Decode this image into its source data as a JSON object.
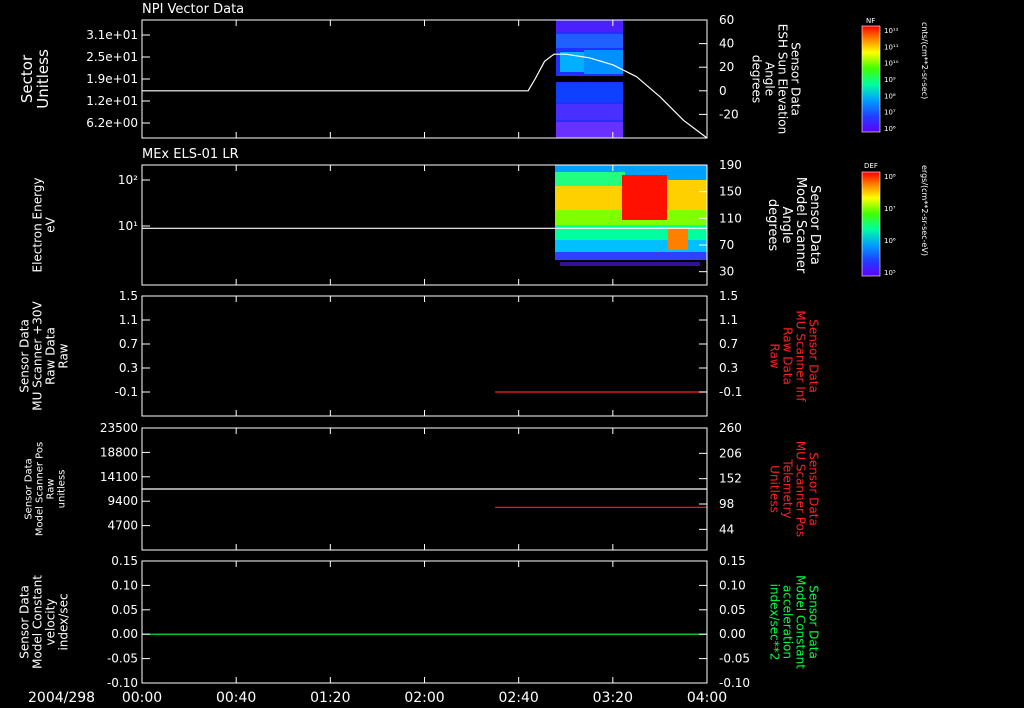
{
  "colors": {
    "background": "#000000",
    "axis": "#ffffff",
    "red": "#ff2020",
    "green": "#00ff40",
    "white": "#ffffff"
  },
  "date_label": "2004/298",
  "time_ticks": [
    "00:00",
    "00:40",
    "01:20",
    "02:00",
    "02:40",
    "03:20",
    "04:00"
  ],
  "chart_data": [
    {
      "type": "heatmap",
      "title": "NPI Vector Data",
      "ylabel_left": [
        "Sector",
        "Unitless"
      ],
      "yticks_left": [
        "3.1e+01",
        "2.5e+01",
        "1.9e+01",
        "1.2e+01",
        "6.2e+00"
      ],
      "ylabel_right": [
        "Sensor Data",
        "ESH Sun Elevation",
        "Angle",
        "degrees"
      ],
      "yticks_right": [
        "60",
        "40",
        "20",
        "0",
        "-20"
      ],
      "ylim_right": [
        -40,
        60
      ],
      "heatmap_time_range": [
        "02:45",
        "03:25"
      ],
      "line_series": {
        "name": "Sun Elevation Angle",
        "color": "#ffffff",
        "x": [
          "00:00",
          "02:44",
          "02:47",
          "02:51",
          "02:55",
          "03:00",
          "03:10",
          "03:20",
          "03:30",
          "03:40",
          "03:50",
          "04:00"
        ],
        "y": [
          0,
          0,
          10,
          25,
          31,
          31,
          28,
          22,
          12,
          -5,
          -25,
          -40
        ]
      },
      "colorbar": {
        "label": "NF",
        "units": "cnts/(cm**2-sr-sec)",
        "ticks": [
          "10¹²",
          "10¹¹",
          "10¹⁰",
          "10⁹",
          "10⁸",
          "10⁷",
          "10⁶"
        ]
      }
    },
    {
      "type": "heatmap",
      "title": "MEx ELS-01 LR",
      "ylabel_left": [
        "Electron Energy",
        "eV"
      ],
      "yticks_left": [
        "10²",
        "10¹"
      ],
      "ylabel_right": [
        "Sensor Data",
        "Model Scanner",
        "Angle",
        "degrees"
      ],
      "yticks_right": [
        "190",
        "150",
        "110",
        "70",
        "30"
      ],
      "ylim_right": [
        10,
        190
      ],
      "heatmap_time_range": [
        "02:44",
        "04:00"
      ],
      "line_series": {
        "name": "Model Scanner Angle",
        "color": "#ffffff",
        "x": [
          "00:00",
          "04:00"
        ],
        "y": [
          95,
          95
        ]
      },
      "colorbar": {
        "label": "DEF",
        "units": "ergs/(cm**2-sr-sec-eV)",
        "ticks": [
          "10⁸",
          "10⁷",
          "10⁶",
          "10⁵"
        ]
      }
    },
    {
      "type": "line",
      "ylabel_left": [
        "Sensor Data",
        "MU Scanner +30V",
        "Raw Data",
        "Raw"
      ],
      "yticks_left": [
        "1.5",
        "1.1",
        "0.7",
        "0.3",
        "-0.1"
      ],
      "ylim_left": [
        -0.5,
        1.5
      ],
      "ylabel_right": [
        "Sensor Data",
        "MU Scanner Inf",
        "Raw Data",
        "Raw"
      ],
      "yticks_right": [
        "1.5",
        "1.1",
        "0.7",
        "0.3",
        "-0.1"
      ],
      "ylim_right": [
        -0.5,
        1.5
      ],
      "series": [
        {
          "color": "#ff2020",
          "axis": "right",
          "x": [
            "02:30",
            "04:00"
          ],
          "y": [
            -0.1,
            -0.1
          ]
        }
      ]
    },
    {
      "type": "line",
      "ylabel_left": [
        "Sensor Data",
        "Model Scanner Pos",
        "Raw",
        "unitless"
      ],
      "yticks_left": [
        "23500",
        "18800",
        "14100",
        "9400",
        "4700"
      ],
      "ylim_left": [
        0,
        23500
      ],
      "ylabel_right": [
        "Sensor Data",
        "MU Scanner Pos",
        "Telemetry",
        "Unitless"
      ],
      "yticks_right": [
        "260",
        "206",
        "152",
        "98",
        "44"
      ],
      "ylim_right": [
        0,
        260
      ],
      "series": [
        {
          "color": "#ffffff",
          "axis": "left",
          "x": [
            "00:00",
            "04:00"
          ],
          "y": [
            11750,
            11750
          ]
        },
        {
          "color": "#ff2020",
          "axis": "right",
          "x": [
            "02:30",
            "04:00"
          ],
          "y": [
            91,
            91
          ]
        }
      ]
    },
    {
      "type": "line",
      "ylabel_left": [
        "Sensor Data",
        "Model Constant",
        "velocity",
        "index/sec"
      ],
      "yticks_left": [
        "0.15",
        "0.10",
        "0.05",
        "0.00",
        "-0.05",
        "-0.10"
      ],
      "ylim_left": [
        -0.1,
        0.15
      ],
      "ylabel_right": [
        "Sensor Data",
        "Model Constant",
        "acceleration",
        "index/sec**2"
      ],
      "yticks_right": [
        "0.15",
        "0.10",
        "0.05",
        "0.00",
        "-0.05",
        "-0.10"
      ],
      "ylim_right": [
        -0.1,
        0.15
      ],
      "series": [
        {
          "color": "#00ff40",
          "axis": "left",
          "x": [
            "00:00",
            "04:00"
          ],
          "y": [
            0.0,
            0.0
          ]
        }
      ]
    }
  ]
}
